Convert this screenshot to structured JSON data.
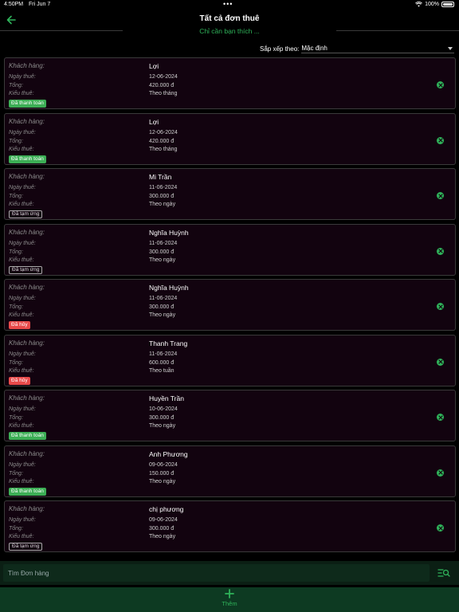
{
  "status_bar": {
    "time": "4:50PM",
    "date": "Fri Jun 7",
    "battery": "100%"
  },
  "header": {
    "title": "Tất cả đơn thuê",
    "search_hint": "Chỉ cần bạn thích ..."
  },
  "sort": {
    "label": "Sắp xếp theo:",
    "value": "Mặc định"
  },
  "labels": {
    "customer": "Khách hàng:",
    "date": "Ngày thuê:",
    "total": "Tổng:",
    "type": "Kiểu thuê:"
  },
  "orders": [
    {
      "name": "Lợi",
      "date": "12-06-2024",
      "total": "420.000 đ",
      "type": "Theo tháng",
      "status": "Đã thanh toán",
      "status_kind": "paid"
    },
    {
      "name": "Lợi",
      "date": "12-06-2024",
      "total": "420.000 đ",
      "type": "Theo tháng",
      "status": "Đã thanh toán",
      "status_kind": "paid"
    },
    {
      "name": "Mi Trần",
      "date": "11-06-2024",
      "total": "300.000 đ",
      "type": "Theo ngày",
      "status": "Đã tạm ứng",
      "status_kind": "advance"
    },
    {
      "name": "Nghĩa Huỳnh",
      "date": "11-06-2024",
      "total": "300.000 đ",
      "type": "Theo ngày",
      "status": "Đã tạm ứng",
      "status_kind": "advance"
    },
    {
      "name": "Nghĩa Huỳnh",
      "date": "11-06-2024",
      "total": "300.000 đ",
      "type": "Theo ngày",
      "status": "Đã hủy",
      "status_kind": "cancel"
    },
    {
      "name": "Thanh Trang",
      "date": "11-06-2024",
      "total": "600.000 đ",
      "type": "Theo tuần",
      "status": "Đã hủy",
      "status_kind": "cancel"
    },
    {
      "name": "Huyền Trần",
      "date": "10-06-2024",
      "total": "300.000 đ",
      "type": "Theo ngày",
      "status": "Đã thanh toán",
      "status_kind": "paid"
    },
    {
      "name": "Anh Phương",
      "date": "09-06-2024",
      "total": "150.000 đ",
      "type": "Theo ngày",
      "status": "Đã thanh toán",
      "status_kind": "paid"
    },
    {
      "name": "chị phương",
      "date": "09-06-2024",
      "total": "300.000 đ",
      "type": "Theo ngày",
      "status": "Đã tạm ứng",
      "status_kind": "advance"
    }
  ],
  "search": {
    "placeholder": "Tìm Đơn hàng"
  },
  "add": {
    "label": "Thêm"
  },
  "colors": {
    "accent": "#2fb35a",
    "paid": "#3cae55",
    "cancel": "#e84a4a",
    "card_bg": "#12030f"
  }
}
